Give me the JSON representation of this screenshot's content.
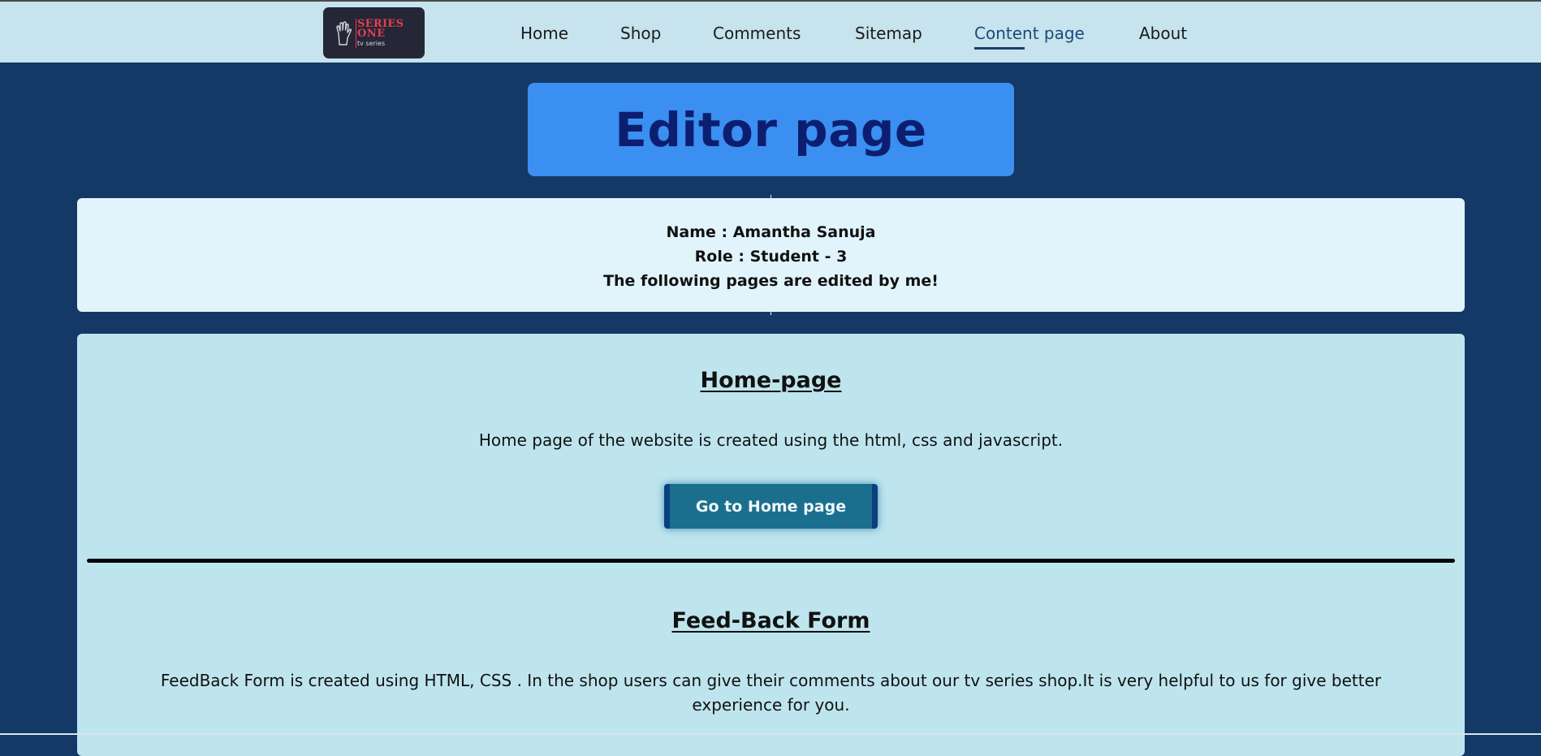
{
  "header": {
    "logo": {
      "line1": "SERIES",
      "line2": "ONE",
      "line3": "tv series",
      "icon": "hand-icon"
    },
    "nav": [
      {
        "label": "Home"
      },
      {
        "label": "Shop"
      },
      {
        "label": "Comments"
      },
      {
        "label": "Sitemap"
      },
      {
        "label": "Content page",
        "active": true
      },
      {
        "label": "About"
      }
    ]
  },
  "page": {
    "title": "Editor page"
  },
  "info": {
    "name": "Name : Amantha Sanuja",
    "role": "Role : Student - 3",
    "note": "The following pages are edited by me!"
  },
  "sections": [
    {
      "title": "Home-page",
      "text": "Home page of the website is created using the html, css and javascript.",
      "button": "Go to Home page"
    },
    {
      "title": "Feed-Back Form",
      "text": "FeedBack Form is created using HTML, CSS . In the shop users can give their comments about our tv series shop.It is very helpful to us for give better experience for you."
    }
  ],
  "colors": {
    "background": "#143966",
    "navbar": "#c6e3ee",
    "title_box": "#3a8ff1",
    "title_text": "#0d1e70",
    "info_card": "#e1f4fc",
    "content_card": "#bee5ee",
    "button": "#1a6f8e",
    "logo_red": "#e2404f"
  }
}
